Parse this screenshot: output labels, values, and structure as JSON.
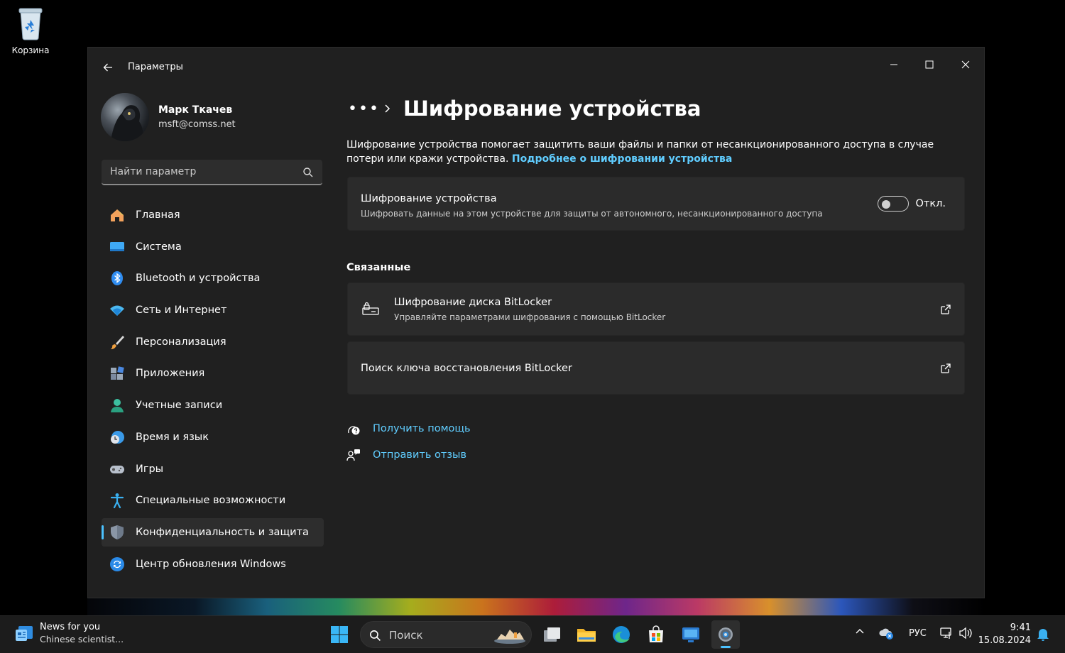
{
  "desktop": {
    "recycle_bin_label": "Корзина"
  },
  "window": {
    "app_title": "Параметры"
  },
  "profile": {
    "name": "Марк Ткачев",
    "email": "msft@comss.net"
  },
  "search": {
    "placeholder": "Найти параметр"
  },
  "nav": {
    "items": [
      {
        "label": "Главная",
        "icon": "home-icon"
      },
      {
        "label": "Система",
        "icon": "system-icon"
      },
      {
        "label": "Bluetooth и устройства",
        "icon": "bluetooth-icon"
      },
      {
        "label": "Сеть и Интернет",
        "icon": "wifi-icon"
      },
      {
        "label": "Персонализация",
        "icon": "brush-icon"
      },
      {
        "label": "Приложения",
        "icon": "apps-icon"
      },
      {
        "label": "Учетные записи",
        "icon": "account-icon"
      },
      {
        "label": "Время и язык",
        "icon": "time-language-icon"
      },
      {
        "label": "Игры",
        "icon": "gamepad-icon"
      },
      {
        "label": "Специальные возможности",
        "icon": "accessibility-icon"
      },
      {
        "label": "Конфиденциальность и защита",
        "icon": "shield-icon",
        "active": true
      },
      {
        "label": "Центр обновления Windows",
        "icon": "update-icon"
      }
    ]
  },
  "main": {
    "breadcrumb_more": "•••",
    "title": "Шифрование устройства",
    "description": "Шифрование устройства помогает защитить ваши файлы и папки от несанкционированного доступа в случае потери или кражи устройства.",
    "description_link": "Подробнее о шифровании устройства",
    "encryption_card": {
      "title": "Шифрование устройства",
      "subtitle": "Шифровать данные на этом устройстве для защиты от автономного, несанкционированного доступа",
      "toggle_state": "Откл.",
      "toggle_on": false
    },
    "related_title": "Связанные",
    "related": [
      {
        "title": "Шифрование диска BitLocker",
        "subtitle": "Управляйте параметрами шифрования с помощью BitLocker"
      },
      {
        "title": "Поиск ключа восстановления BitLocker"
      }
    ],
    "help_links": [
      {
        "label": "Получить помощь",
        "icon": "help-icon"
      },
      {
        "label": "Отправить отзыв",
        "icon": "feedback-icon"
      }
    ]
  },
  "taskbar": {
    "news_title": "News for you",
    "news_subtitle": "Chinese scientist...",
    "search_label": "Поиск",
    "language": "РУС",
    "time": "9:41",
    "date": "15.08.2024"
  },
  "colors": {
    "accent": "#60cdff",
    "window_bg": "#202020",
    "card_bg": "#2b2b2b"
  }
}
